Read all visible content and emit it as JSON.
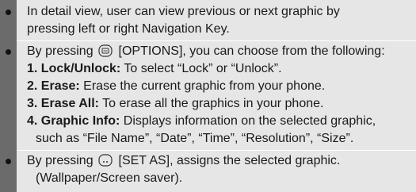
{
  "items": [
    {
      "lines": [
        "In detail view, user can view previous or next graphic by",
        "pressing left or right Navigation Key."
      ]
    },
    {
      "intro_pre": "By pressing",
      "intro_icon": "options-softkey-icon",
      "intro_post": "[OPTIONS], you can choose from the following:",
      "options": [
        {
          "label": "1. Lock/Unlock:",
          "text": "To select “Lock” or “Unlock”."
        },
        {
          "label": "2. Erase:",
          "text": "Erase the current graphic from your phone."
        },
        {
          "label": "3. Erase All:",
          "text": "To erase all the graphics in your phone."
        },
        {
          "label": "4. Graphic Info:",
          "text": "Displays information on the selected graphic,"
        }
      ],
      "option4_cont": "such as “File Name”, “Date”, “Time”, “Resolution”, “Size”."
    },
    {
      "intro_pre": "By pressing",
      "intro_icon": "set-as-softkey-icon",
      "intro_post": "[SET AS], assigns the selected graphic.",
      "cont": "(Wallpaper/Screen saver)."
    }
  ]
}
